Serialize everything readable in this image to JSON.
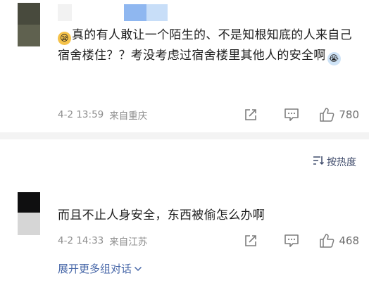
{
  "comments": [
    {
      "text_main": "真的有人敢让一个陌生的、不是知根知底的人来自己宿舍楼住？？考没考虑过宿舍楼里其他人的安全啊",
      "date": "4-2 13:59",
      "location": "来自重庆",
      "likes": "780",
      "emoji_lead": "sleepy-face-emoji",
      "emoji_trail": "crying-face-emoji"
    },
    {
      "text_main": "而且不止人身安全，东西被偷怎么办啊",
      "date": "4-2 14:33",
      "location": "来自江苏",
      "likes": "468"
    }
  ],
  "sort": {
    "label": "按热度",
    "icon": "sort-icon"
  },
  "expand": {
    "label": "展开更多组对话"
  },
  "colors": {
    "link": "#4767a8",
    "meta": "#8e8e8e",
    "divider": "#f3f3f3",
    "avatar1_top": "#484a3d",
    "avatar1_bottom": "#5f614f",
    "avatar2_top": "#0f0f10",
    "avatar2_bottom": "#d6d6d6",
    "name_blur_blue": "#8fb7f0",
    "name_blur_light": "#c8def8"
  },
  "icons": [
    "forward-icon",
    "comment-icon",
    "like-icon",
    "chevron-down-icon"
  ]
}
